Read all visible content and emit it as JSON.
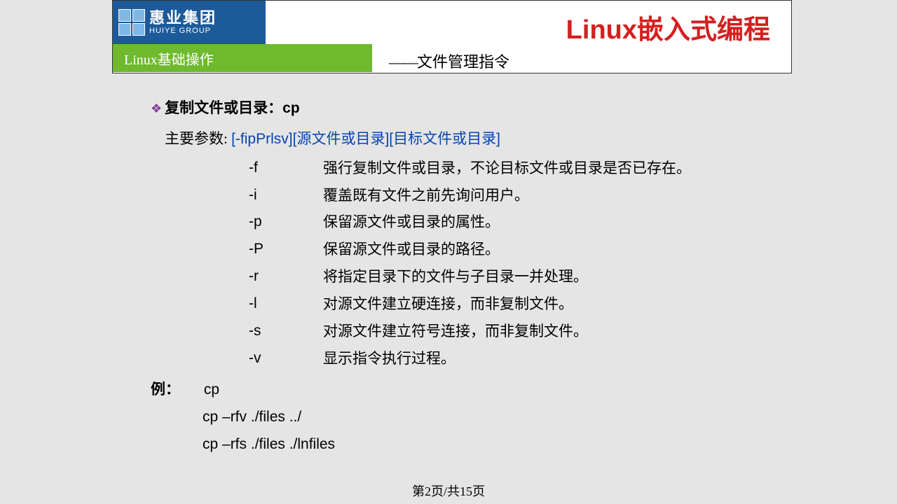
{
  "header": {
    "logo_cn": "惠业集团",
    "logo_en": "HUIYE GROUP",
    "subtitle": "Linux基础操作",
    "main_title": "Linux嵌入式编程",
    "sub_title_dash": "——",
    "sub_title_text": "文件管理指令"
  },
  "content": {
    "section_title": "复制文件或目录：",
    "section_cmd": "cp",
    "params_label": "主要参数: ",
    "params_flags": "[-fipPrlsv]",
    "params_src": "[源文件或目录]",
    "params_dst": "[目标文件或目录]",
    "options": [
      {
        "flag": "-f",
        "desc": "强行复制文件或目录，不论目标文件或目录是否已存在。"
      },
      {
        "flag": "-i",
        "desc": "覆盖既有文件之前先询问用户。"
      },
      {
        "flag": "-p",
        "desc": "保留源文件或目录的属性。"
      },
      {
        "flag": "-P",
        "desc": "保留源文件或目录的路径。"
      },
      {
        "flag": "-r",
        "desc": "将指定目录下的文件与子目录一并处理。"
      },
      {
        "flag": "-l",
        "desc": "对源文件建立硬连接，而非复制文件。"
      },
      {
        "flag": "-s",
        "desc": "对源文件建立符号连接，而非复制文件。"
      },
      {
        "flag": "-v",
        "desc": "显示指令执行过程。"
      }
    ],
    "example_label": "例：",
    "example_cmd": "cp",
    "example_lines": [
      "cp –rfv ./files ../",
      "cp –rfs ./files ./lnfiles"
    ]
  },
  "footer": {
    "page_text": "第2页/共15页"
  }
}
